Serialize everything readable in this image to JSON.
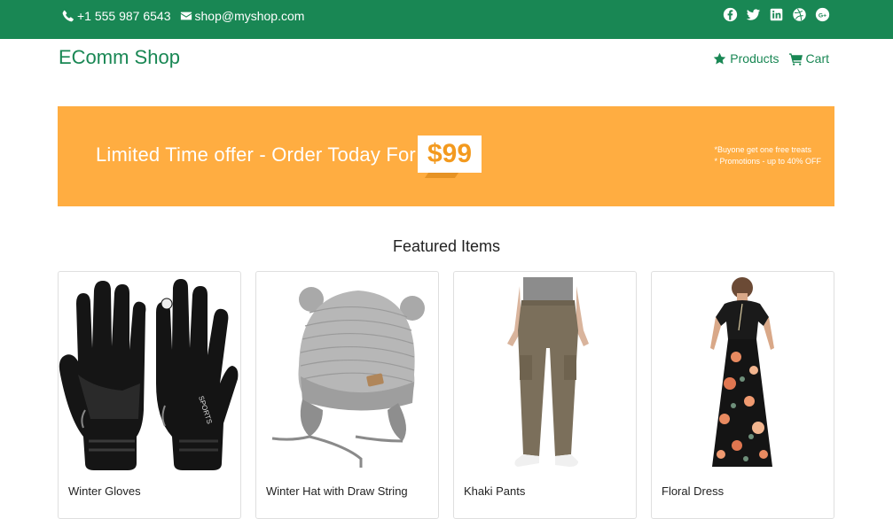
{
  "topbar": {
    "phone": "+1 555 987 6543",
    "email": "shop@myshop.com",
    "socials": [
      "facebook-icon",
      "twitter-icon",
      "linkedin-icon",
      "dribbble-icon",
      "google-plus-icon"
    ]
  },
  "navbar": {
    "brand": "EComm Shop",
    "links": [
      {
        "label": "Products",
        "icon": "star-icon"
      },
      {
        "label": "Cart",
        "icon": "cart-icon"
      }
    ]
  },
  "banner": {
    "headline": "Limited Time offer - Order Today For",
    "price": "$99",
    "promo_line1": "*Buyone get one free treats",
    "promo_line2": "* Promotions - up to 40% OFF"
  },
  "featured": {
    "title": "Featured Items",
    "items": [
      {
        "name": "Winter Gloves",
        "image": "gloves-image"
      },
      {
        "name": "Winter Hat with Draw String",
        "image": "hat-image"
      },
      {
        "name": "Khaki Pants",
        "image": "pants-image"
      },
      {
        "name": "Floral Dress",
        "image": "dress-image"
      }
    ]
  },
  "colors": {
    "brand_green": "#198754",
    "banner_orange": "#FFAD41"
  }
}
